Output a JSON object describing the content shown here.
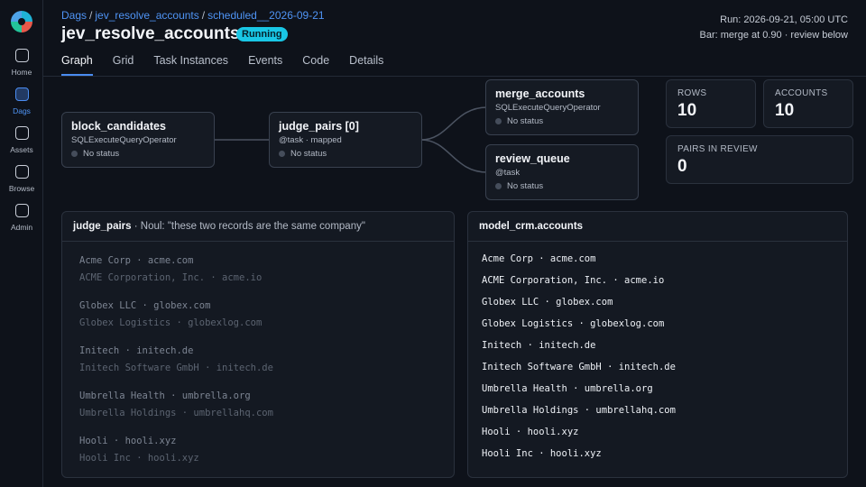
{
  "sidebar": {
    "items": [
      {
        "label": "Home",
        "icon": "home-icon",
        "active": false
      },
      {
        "label": "Dags",
        "icon": "dags-icon",
        "active": true
      },
      {
        "label": "Assets",
        "icon": "assets-icon",
        "active": false
      },
      {
        "label": "Browse",
        "icon": "browse-icon",
        "active": false
      },
      {
        "label": "Admin",
        "icon": "admin-icon",
        "active": false
      }
    ]
  },
  "breadcrumb": {
    "items": [
      "Dags",
      "jev_resolve_accounts",
      "scheduled__2026-09-21"
    ],
    "separator": "/"
  },
  "dag": {
    "title": "jev_resolve_accounts",
    "status": "Running",
    "status_color": "#19c7e6"
  },
  "run_info": {
    "run": "Run: 2026-09-21, 05:00 UTC",
    "bar": "Bar: merge at 0.90 · review below"
  },
  "tabs": [
    {
      "label": "Graph",
      "active": true
    },
    {
      "label": "Grid",
      "active": false
    },
    {
      "label": "Task Instances",
      "active": false
    },
    {
      "label": "Events",
      "active": false
    },
    {
      "label": "Code",
      "active": false
    },
    {
      "label": "Details",
      "active": false
    }
  ],
  "graph": {
    "nodes": [
      {
        "id": "block_candidates",
        "title": "block_candidates",
        "subtitle": "SQLExecuteQueryOperator",
        "status": "No status"
      },
      {
        "id": "judge_pairs",
        "title": "judge_pairs [0]",
        "subtitle": "@task · mapped",
        "status": "No status"
      },
      {
        "id": "merge_accounts",
        "title": "merge_accounts",
        "subtitle": "SQLExecuteQueryOperator",
        "status": "No status"
      },
      {
        "id": "review_queue",
        "title": "review_queue",
        "subtitle": "@task",
        "status": "No status"
      }
    ]
  },
  "stats": [
    {
      "label": "ROWS",
      "value": "10"
    },
    {
      "label": "ACCOUNTS",
      "value": "10"
    },
    {
      "label": "PAIRS IN REVIEW",
      "value": "0"
    }
  ],
  "judge_panel": {
    "title": "judge_pairs",
    "subtitle": " · Noul: \"these two records are the same company\"",
    "pairs": [
      [
        "Acme Corp · acme.com",
        "ACME Corporation, Inc. · acme.io"
      ],
      [
        "Globex LLC · globex.com",
        "Globex Logistics · globexlog.com"
      ],
      [
        "Initech · initech.de",
        "Initech Software GmbH · initech.de"
      ],
      [
        "Umbrella Health · umbrella.org",
        "Umbrella Holdings · umbrellahq.com"
      ],
      [
        "Hooli · hooli.xyz",
        "Hooli Inc · hooli.xyz"
      ]
    ]
  },
  "accounts_panel": {
    "title": "model_crm.accounts",
    "rows": [
      "Acme Corp · acme.com",
      "ACME Corporation, Inc. · acme.io",
      "Globex LLC · globex.com",
      "Globex Logistics · globexlog.com",
      "Initech · initech.de",
      "Initech Software GmbH · initech.de",
      "Umbrella Health · umbrella.org",
      "Umbrella Holdings · umbrellahq.com",
      "Hooli · hooli.xyz",
      "Hooli Inc · hooli.xyz"
    ]
  },
  "colors": {
    "accent": "#4a8cf0",
    "background": "#0e121a",
    "node_border": "#39414f"
  }
}
